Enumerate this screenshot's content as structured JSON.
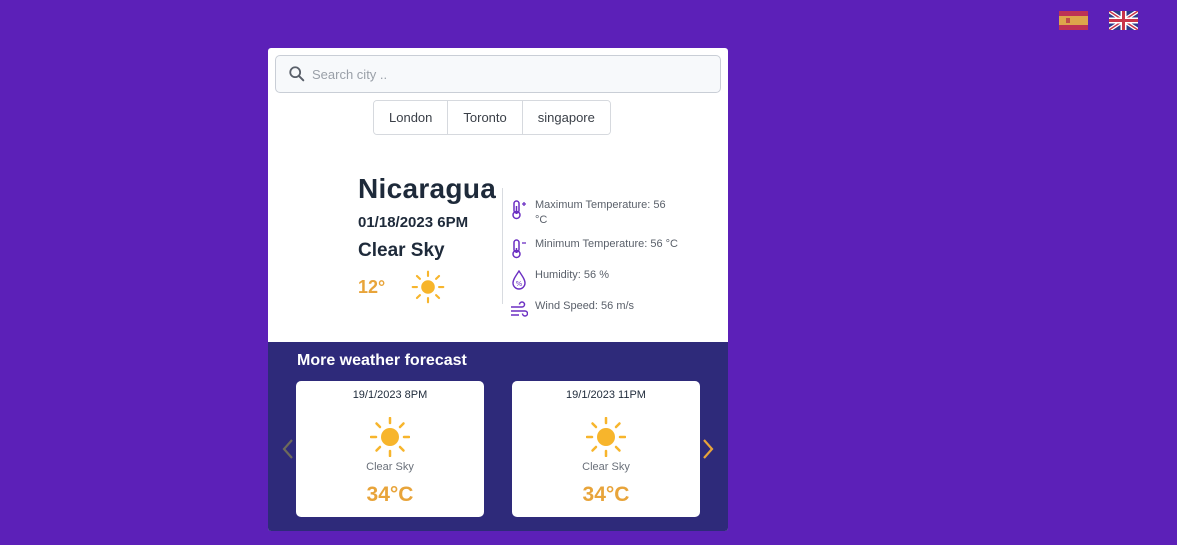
{
  "search": {
    "placeholder": "Search city .."
  },
  "quick_cities": [
    "London",
    "Toronto",
    "singapore"
  ],
  "current": {
    "city": "Nicaragua",
    "datetime": "01/18/2023 6PM",
    "description": "Clear Sky",
    "temperature": "12°",
    "icon": "sun-icon"
  },
  "stats": {
    "max_temp": "Maximum Temperature: 56 °C",
    "min_temp": "Minimum Temperature: 56 °C",
    "humidity": "Humidity: 56 %",
    "wind": "Wind Speed: 56 m/s"
  },
  "forecast": {
    "title": "More weather forecast",
    "items": [
      {
        "datetime": "19/1/2023 8PM",
        "description": "Clear Sky",
        "temperature": "34°C",
        "icon": "sun-icon"
      },
      {
        "datetime": "19/1/2023 11PM",
        "description": "Clear Sky",
        "temperature": "34°C",
        "icon": "sun-icon"
      }
    ]
  },
  "colors": {
    "background": "#5c20b8",
    "forecast_bg": "#2e2a7a",
    "accent_orange": "#e8a43a",
    "icon_purple": "#6b2fc2"
  },
  "languages": [
    "es-flag-icon",
    "uk-flag-icon"
  ]
}
